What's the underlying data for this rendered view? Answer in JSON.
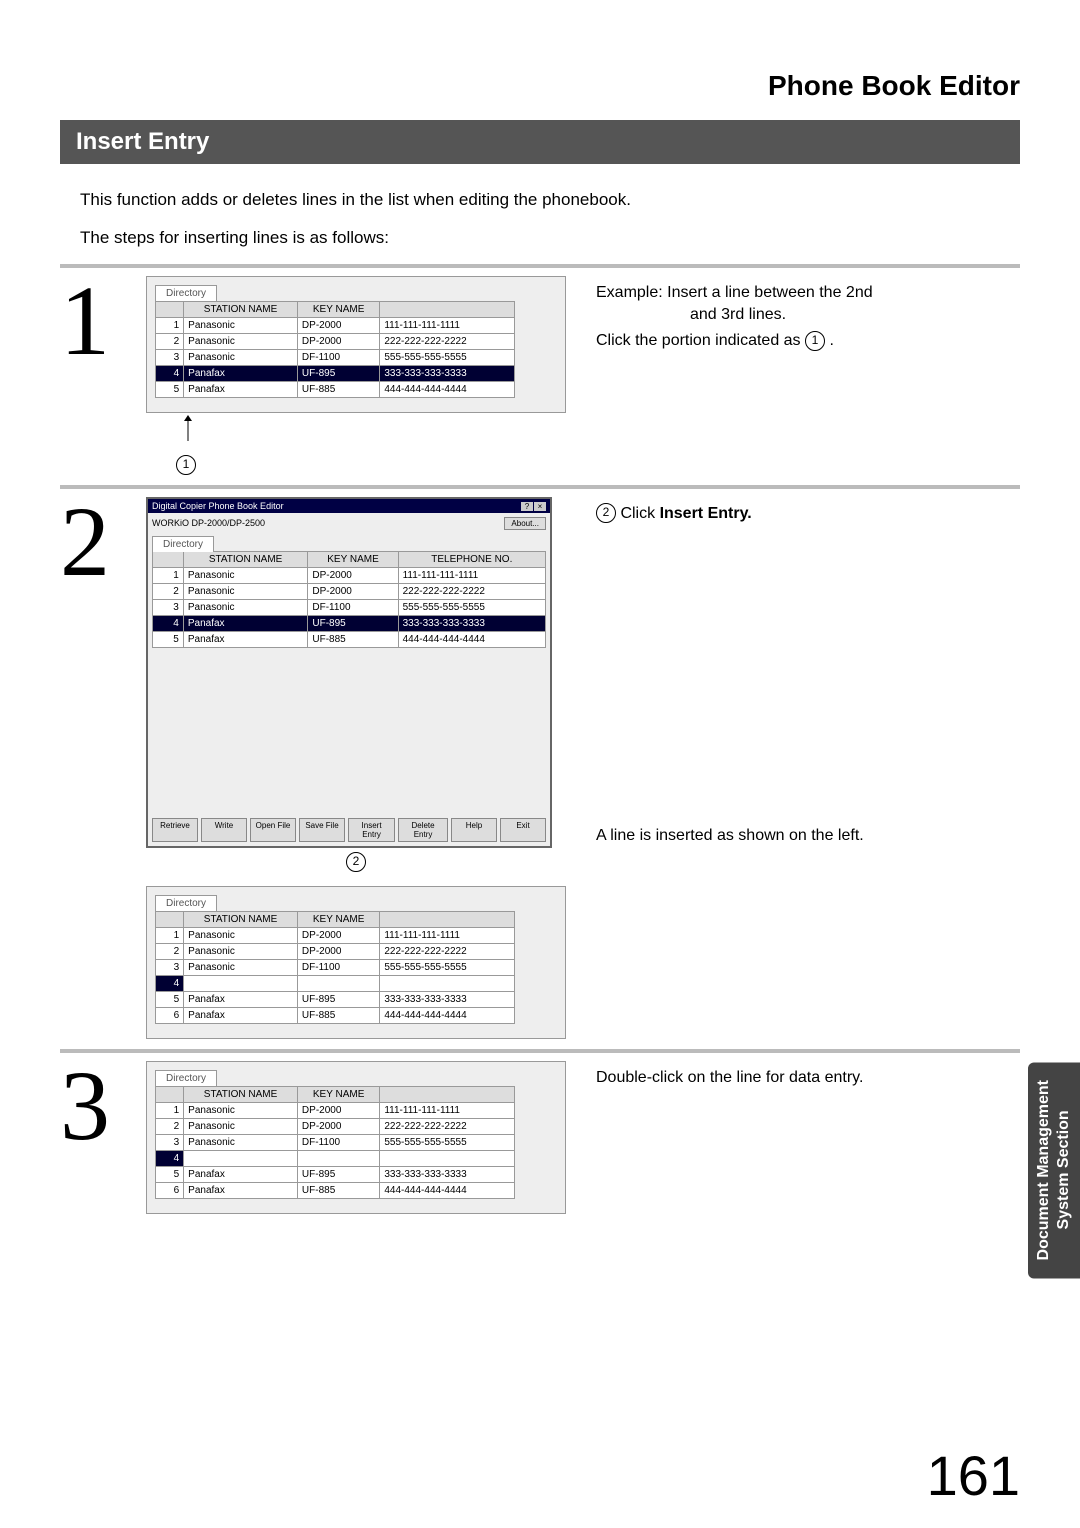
{
  "title": "Phone Book Editor",
  "section_header": "Insert Entry",
  "intro_line1": "This function adds or deletes lines in the list when editing the phonebook.",
  "intro_line2": "The steps for inserting lines is as follows:",
  "side_tab_line1": "Document Management",
  "side_tab_line2": "System Section",
  "page_number": "161",
  "step1": {
    "num": "1",
    "example_prefix": "Example: ",
    "example_text1": "Insert a line between the 2nd",
    "example_text2": "and 3rd lines.",
    "click_text_pre": "Click the portion indicated as ",
    "click_text_post": " .",
    "circled_ref": "1",
    "tab": "Directory",
    "headers": {
      "station": "STATION NAME",
      "key": "KEY NAME",
      "tel": ""
    },
    "rows": [
      {
        "n": "1",
        "station": "Panasonic",
        "key": "DP-2000",
        "tel": "111-111-111-1111",
        "sel": false
      },
      {
        "n": "2",
        "station": "Panasonic",
        "key": "DP-2000",
        "tel": "222-222-222-2222",
        "sel": false
      },
      {
        "n": "3",
        "station": "Panasonic",
        "key": "DF-1100",
        "tel": "555-555-555-5555",
        "sel": false
      },
      {
        "n": "4",
        "station": "Panafax",
        "key": "UF-895",
        "tel": "333-333-333-3333",
        "sel": true
      },
      {
        "n": "5",
        "station": "Panafax",
        "key": "UF-885",
        "tel": "444-444-444-4444",
        "sel": false
      }
    ],
    "callout_circle": "1"
  },
  "step2": {
    "num": "2",
    "instruction_pre": " Click ",
    "instruction_bold": "Insert Entry.",
    "circled_ref": "2",
    "window_title": "Digital Copier Phone Book Editor",
    "subtitle": "WORKiO DP-2000/DP-2500",
    "about_btn": "About...",
    "tab": "Directory",
    "headers": {
      "station": "STATION NAME",
      "key": "KEY NAME",
      "tel": "TELEPHONE NO."
    },
    "rows": [
      {
        "n": "1",
        "station": "Panasonic",
        "key": "DP-2000",
        "tel": "111-111-111-1111",
        "sel": false
      },
      {
        "n": "2",
        "station": "Panasonic",
        "key": "DP-2000",
        "tel": "222-222-222-2222",
        "sel": false
      },
      {
        "n": "3",
        "station": "Panasonic",
        "key": "DF-1100",
        "tel": "555-555-555-5555",
        "sel": false
      },
      {
        "n": "4",
        "station": "Panafax",
        "key": "UF-895",
        "tel": "333-333-333-3333",
        "sel": true
      },
      {
        "n": "5",
        "station": "Panafax",
        "key": "UF-885",
        "tel": "444-444-444-4444",
        "sel": false
      }
    ],
    "buttons": [
      "Retrieve",
      "Write",
      "Open File",
      "Save File",
      "Insert Entry",
      "Delete Entry",
      "Help",
      "Exit"
    ],
    "result_text": "A line is inserted as shown on the left.",
    "result_tab": "Directory",
    "result_headers": {
      "station": "STATION NAME",
      "key": "KEY NAME",
      "tel": ""
    },
    "result_rows": [
      {
        "n": "1",
        "station": "Panasonic",
        "key": "DP-2000",
        "tel": "111-111-111-1111"
      },
      {
        "n": "2",
        "station": "Panasonic",
        "key": "DP-2000",
        "tel": "222-222-222-2222"
      },
      {
        "n": "3",
        "station": "Panasonic",
        "key": "DF-1100",
        "tel": "555-555-555-5555"
      },
      {
        "n": "4",
        "station": "",
        "key": "",
        "tel": ""
      },
      {
        "n": "5",
        "station": "Panafax",
        "key": "UF-895",
        "tel": "333-333-333-3333"
      },
      {
        "n": "6",
        "station": "Panafax",
        "key": "UF-885",
        "tel": "444-444-444-4444"
      }
    ],
    "callout_circle": "2"
  },
  "step3": {
    "num": "3",
    "instruction": "Double-click on the line for data entry.",
    "tab": "Directory",
    "headers": {
      "station": "STATION NAME",
      "key": "KEY NAME",
      "tel": ""
    },
    "rows": [
      {
        "n": "1",
        "station": "Panasonic",
        "key": "DP-2000",
        "tel": "111-111-111-1111"
      },
      {
        "n": "2",
        "station": "Panasonic",
        "key": "DP-2000",
        "tel": "222-222-222-2222"
      },
      {
        "n": "3",
        "station": "Panasonic",
        "key": "DF-1100",
        "tel": "555-555-555-5555"
      },
      {
        "n": "4",
        "station": "",
        "key": "",
        "tel": ""
      },
      {
        "n": "5",
        "station": "Panafax",
        "key": "UF-895",
        "tel": "333-333-333-3333"
      },
      {
        "n": "6",
        "station": "Panafax",
        "key": "UF-885",
        "tel": "444-444-444-4444"
      }
    ]
  }
}
